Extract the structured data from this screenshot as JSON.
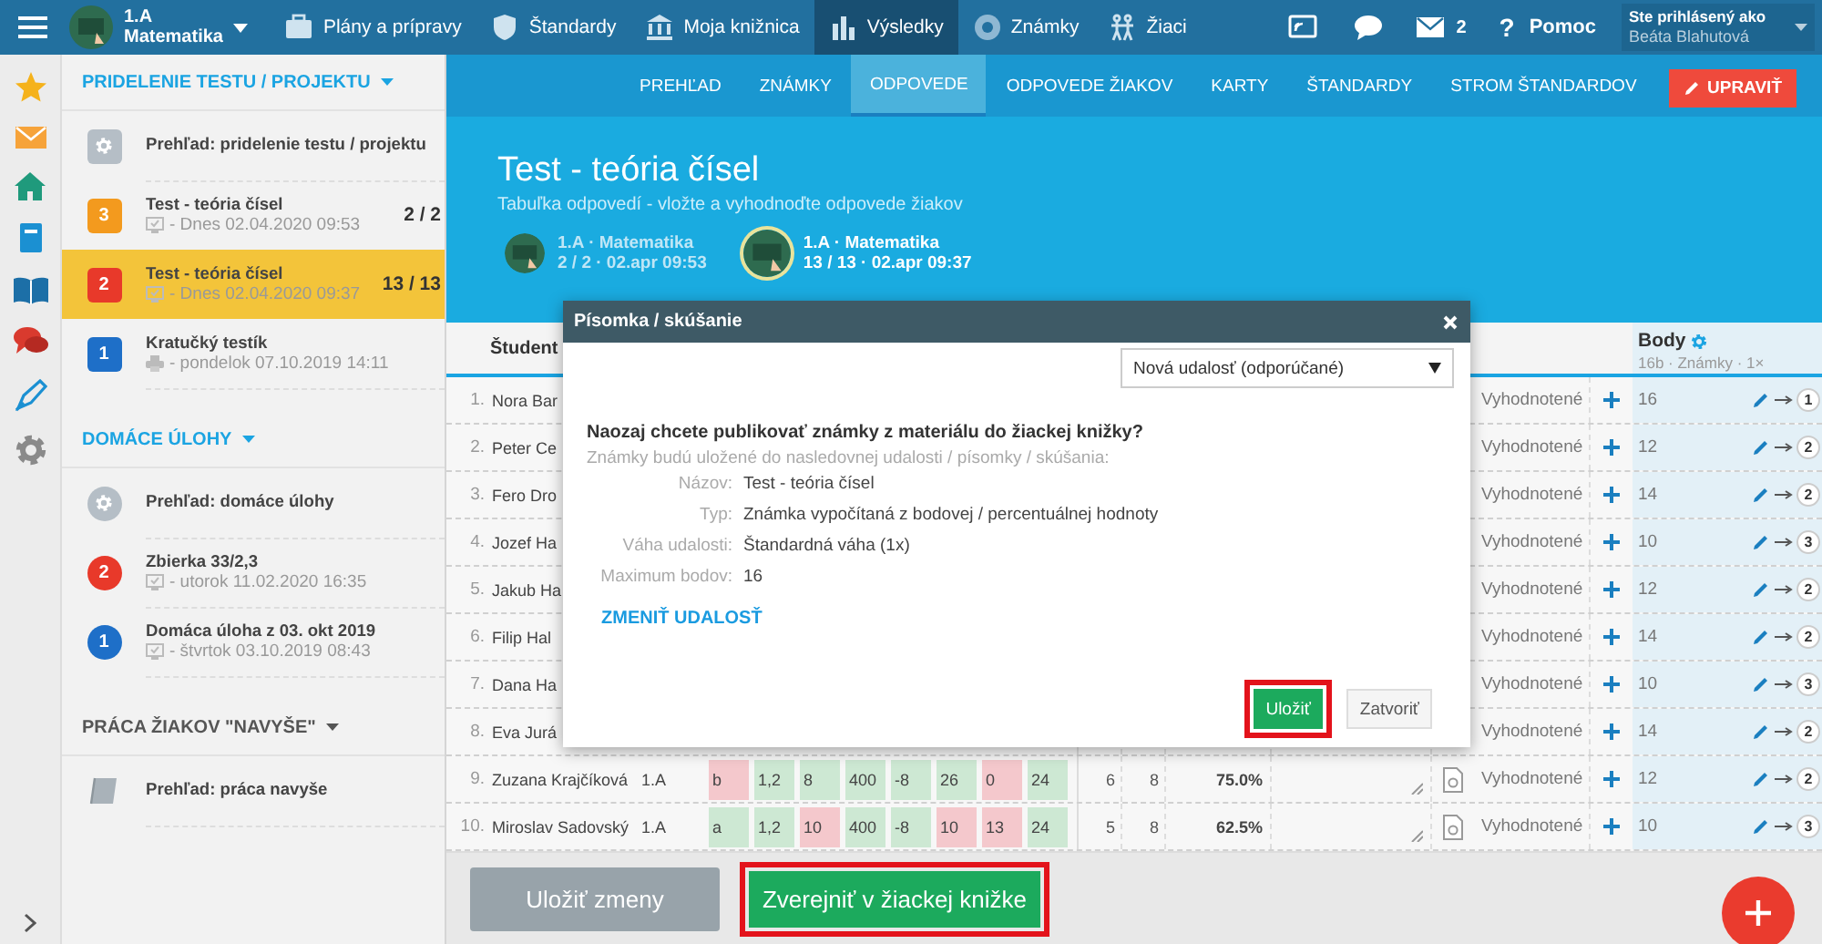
{
  "top_nav": {
    "class_label": "1.A",
    "subject": "Matematika",
    "items": [
      {
        "label": "Plány a prípravy",
        "selected": false
      },
      {
        "label": "Štandardy",
        "selected": false
      },
      {
        "label": "Moja knižnica",
        "selected": false
      },
      {
        "label": "Výsledky",
        "selected": true
      },
      {
        "label": "Známky",
        "selected": false
      },
      {
        "label": "Žiaci",
        "selected": false
      }
    ],
    "messages_count": "2",
    "help_glyph": "?",
    "help": "Pomoc",
    "user_caption": "Ste prihlásený ako",
    "user_name": "Beáta Blahutová"
  },
  "sidebar": {
    "sections": [
      {
        "title": "PRIDELENIE TESTU / PROJEKTU",
        "kind": "tests",
        "items": [
          {
            "kind": "overview",
            "title": "Prehľad: pridelenie testu / projektu",
            "selected": false
          },
          {
            "kind": "online",
            "badge": "3",
            "color": "#f39a1e",
            "title": "Test - teória čísel",
            "date": "- Dnes 02.04.2020 09:53",
            "count": "2 / 2",
            "selected": false
          },
          {
            "kind": "online",
            "badge": "2",
            "color": "#e8392a",
            "title": "Test - teória čísel",
            "date": "- Dnes 02.04.2020 09:37",
            "count": "13 / 13",
            "selected": true
          },
          {
            "kind": "printed",
            "badge": "1",
            "color": "#1e6fc8",
            "title": "Kratučký testík",
            "date": "- pondelok 07.10.2019 14:11",
            "selected": false
          }
        ]
      },
      {
        "title": "DOMÁCE ÚLOHY",
        "kind": "homework",
        "items": [
          {
            "kind": "overview",
            "title": "Prehľad: domáce úlohy",
            "selected": false
          },
          {
            "kind": "online",
            "badge": "2",
            "color": "#e8392a",
            "title": "Zbierka 33/2,3",
            "date": "- utorok 11.02.2020 16:35",
            "selected": false
          },
          {
            "kind": "online",
            "badge": "1",
            "color": "#1e6fc8",
            "title": "Domáca úloha z 03. okt 2019",
            "date": "- štvrtok 03.10.2019 08:43",
            "selected": false
          }
        ]
      },
      {
        "title": "PRÁCA ŽIAKOV \"NAVYŠE\"",
        "kind": "extra",
        "items": [
          {
            "kind": "book",
            "title": "Prehľad: práca navyše",
            "selected": false
          }
        ]
      }
    ]
  },
  "main": {
    "tabs": [
      {
        "label": "PREHĽAD",
        "selected": false
      },
      {
        "label": "ZNÁMKY",
        "selected": false
      },
      {
        "label": "ODPOVEDE",
        "selected": true
      },
      {
        "label": "ODPOVEDE ŽIAKOV",
        "selected": false
      },
      {
        "label": "KARTY",
        "selected": false
      },
      {
        "label": "ŠTANDARDY",
        "selected": false
      },
      {
        "label": "STROM ŠTANDARDOV",
        "selected": false
      }
    ],
    "edit_button": "UPRAVIŤ",
    "header": {
      "title": "Test - teória čísel",
      "subtitle": "Tabuľka odpovedí - vložte a vyhodnoďte odpovede žiakov",
      "classes": [
        {
          "name": "1.A · Matematika",
          "detail": "2 / 2 · 02.apr 09:53",
          "selected": false
        },
        {
          "name": "1.A · Matematika",
          "detail": "13 / 13 · 02.apr 09:37",
          "selected": true
        }
      ]
    }
  },
  "table": {
    "student_heading": "Študent",
    "points_heading": "Body",
    "points_detail": "16b · Známky · 1×",
    "rows": [
      {
        "kind": "partial",
        "number": "1.",
        "name": "Nora Bar",
        "status": "Vyhodnotené",
        "points": "16",
        "grade": "1"
      },
      {
        "kind": "partial",
        "number": "2.",
        "name": "Peter Ce",
        "status": "Vyhodnotené",
        "points": "12",
        "grade": "2"
      },
      {
        "kind": "partial",
        "number": "3.",
        "name": "Fero Dro",
        "status": "Vyhodnotené",
        "points": "14",
        "grade": "2"
      },
      {
        "kind": "partial",
        "number": "4.",
        "name": "Jozef Ha",
        "status": "Vyhodnotené",
        "points": "10",
        "grade": "3"
      },
      {
        "kind": "partial",
        "number": "5.",
        "name": "Jakub Ha",
        "status": "Vyhodnotené",
        "points": "12",
        "grade": "2"
      },
      {
        "kind": "partial",
        "number": "6.",
        "name": "Filip Hal",
        "status": "Vyhodnotené",
        "points": "14",
        "grade": "2"
      },
      {
        "kind": "partial",
        "number": "7.",
        "name": "Dana Ha",
        "status": "Vyhodnotené",
        "points": "10",
        "grade": "3"
      },
      {
        "kind": "partial",
        "number": "8.",
        "name": "Eva Jurá",
        "status": "Vyhodnotené",
        "points": "14",
        "grade": "2"
      },
      {
        "kind": "full",
        "number": "9.",
        "name": "Zuzana Krajčíková",
        "class": "1.A",
        "answers": [
          {
            "value": "b",
            "correct": false
          },
          {
            "value": "1,2",
            "correct": true
          },
          {
            "value": "8",
            "correct": true
          },
          {
            "value": "400",
            "correct": true
          },
          {
            "value": "-8",
            "correct": true
          },
          {
            "value": "26",
            "correct": true
          },
          {
            "value": "0",
            "correct": false
          },
          {
            "value": "24",
            "correct": true
          }
        ],
        "count_1": "6",
        "count_2": "8",
        "percent": "75.0%",
        "status": "Vyhodnotené",
        "points": "12",
        "grade": "2"
      },
      {
        "kind": "full",
        "number": "10.",
        "name": "Miroslav Sadovský",
        "class": "1.A",
        "answers": [
          {
            "value": "a",
            "correct": true
          },
          {
            "value": "1,2",
            "correct": true
          },
          {
            "value": "10",
            "correct": false
          },
          {
            "value": "400",
            "correct": true
          },
          {
            "value": "-8",
            "correct": true
          },
          {
            "value": "10",
            "correct": false
          },
          {
            "value": "13",
            "correct": false
          },
          {
            "value": "24",
            "correct": true
          }
        ],
        "count_1": "5",
        "count_2": "8",
        "percent": "62.5%",
        "status": "Vyhodnotené",
        "points": "10",
        "grade": "3"
      }
    ]
  },
  "footer": {
    "save_button": {
      "label": "Uložiť zmeny",
      "disabled": true
    },
    "publish_button": {
      "label": "Zverejniť v žiackej knižke",
      "highlighted": true
    }
  },
  "modal": {
    "title": "Písomka / skúšanie",
    "select_value": "Nová udalosť (odporúčané)",
    "question": "Naozaj chcete publikovať známky z materiálu do žiackej knižky?",
    "note": "Známky budú uložené do nasledovnej udalosti / písomky / skúšania:",
    "fields": [
      {
        "label": "Názov:",
        "value": "Test - teória čísel"
      },
      {
        "label": "Typ:",
        "value": "Známka vypočítaná z bodovej / percentuálnej hodnoty"
      },
      {
        "label": "Váha udalosti:",
        "value": "Štandardná váha (1x)"
      },
      {
        "label": "Maximum bodov:",
        "value": "16"
      }
    ],
    "link": "ZMENIŤ UDALOSŤ",
    "buttons": [
      {
        "label": "Uložiť",
        "kind": "primary",
        "highlighted": true
      },
      {
        "label": "Zatvoriť",
        "kind": "default",
        "highlighted": false
      }
    ]
  }
}
